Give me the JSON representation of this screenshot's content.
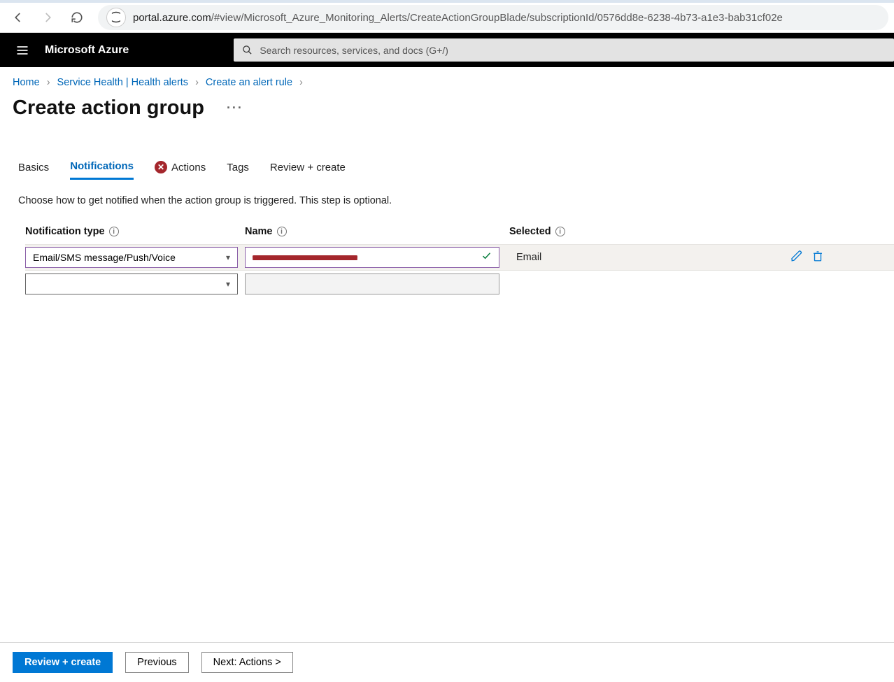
{
  "browser": {
    "url_host": "portal.azure.com",
    "url_path": "/#view/Microsoft_Azure_Monitoring_Alerts/CreateActionGroupBlade/subscriptionId/0576dd8e-6238-4b73-a1e3-bab31cf02e"
  },
  "azure": {
    "brand": "Microsoft Azure",
    "search_placeholder": "Search resources, services, and docs (G+/)"
  },
  "breadcrumb": {
    "items": [
      "Home",
      "Service Health | Health alerts",
      "Create an alert rule"
    ]
  },
  "page": {
    "title": "Create action group",
    "hint": "Choose how to get notified when the action group is triggered. This step is optional."
  },
  "tabs": {
    "items": [
      "Basics",
      "Notifications",
      "Actions",
      "Tags",
      "Review + create"
    ],
    "active": "Notifications",
    "error_on": "Actions"
  },
  "table": {
    "headers": {
      "type": "Notification type",
      "name": "Name",
      "selected": "Selected"
    },
    "rows": [
      {
        "type": "Email/SMS message/Push/Voice",
        "name_redacted": true,
        "validated": true,
        "selected": "Email"
      },
      {
        "type": "",
        "name_redacted": false,
        "validated": false,
        "selected": ""
      }
    ]
  },
  "footer": {
    "review": "Review + create",
    "previous": "Previous",
    "next": "Next: Actions >"
  }
}
